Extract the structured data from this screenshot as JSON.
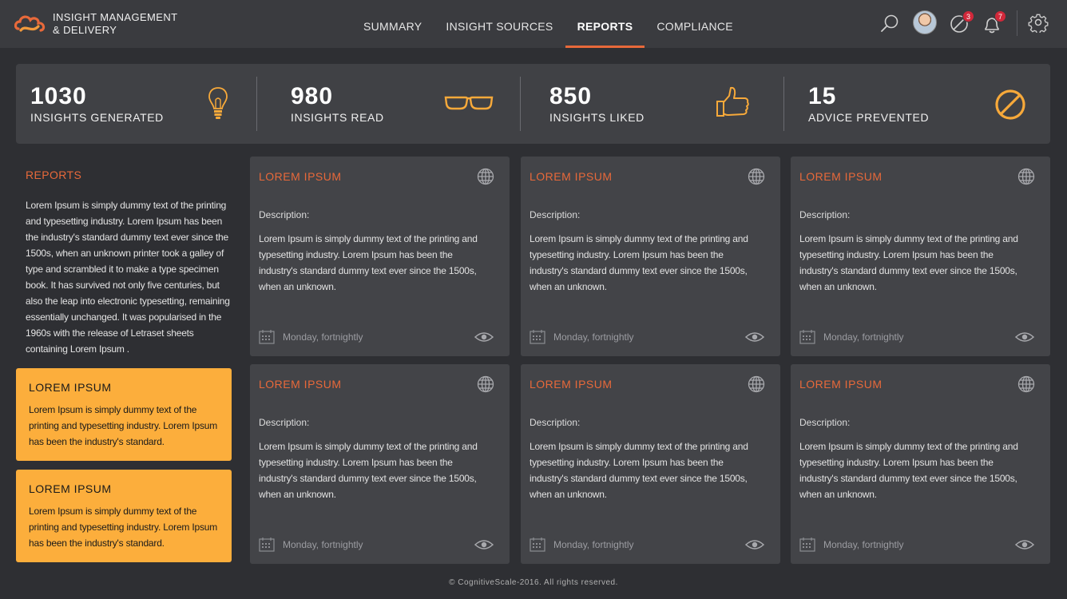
{
  "header": {
    "brand_line1": "INSIGHT MANAGEMENT",
    "brand_line2": "& DELIVERY",
    "nav": [
      {
        "label": "SUMMARY",
        "active": false
      },
      {
        "label": "INSIGHT SOURCES",
        "active": false
      },
      {
        "label": "REPORTS",
        "active": true
      },
      {
        "label": "COMPLIANCE",
        "active": false
      }
    ],
    "blocked_badge": "3",
    "notifications_badge": "7",
    "icons": [
      "search-icon",
      "avatar",
      "blocked-icon",
      "bell-icon",
      "gear-icon"
    ],
    "accent_color": "#e8693a"
  },
  "stats": [
    {
      "value": "1030",
      "label": "INSIGHTS GENERATED",
      "icon": "lightbulb-icon"
    },
    {
      "value": "980",
      "label": "INSIGHTS READ",
      "icon": "glasses-icon"
    },
    {
      "value": "850",
      "label": "INSIGHTS LIKED",
      "icon": "thumbs-up-icon"
    },
    {
      "value": "15",
      "label": "ADVICE PREVENTED",
      "icon": "prohibited-icon"
    }
  ],
  "reports": {
    "title": "REPORTS",
    "description": "Lorem Ipsum is simply dummy text of the printing and typesetting industry. Lorem Ipsum has been the industry's standard dummy text ever since the 1500s, when an unknown printer took a galley of type and scrambled it to make a type specimen book. It has survived not only five centuries, but also the leap into electronic typesetting, remaining essentially unchanged. It was popularised in the 1960s with the release of Letraset sheets containing Lorem Ipsum ."
  },
  "callouts": [
    {
      "title": "LOREM IPSUM",
      "text": "Lorem Ipsum is simply dummy text of the printing and typesetting industry. Lorem Ipsum has been the industry's standard."
    },
    {
      "title": "LOREM IPSUM",
      "text": "Lorem Ipsum is simply dummy text of the printing and typesetting industry. Lorem Ipsum has been the industry's standard."
    }
  ],
  "cards": [
    {
      "title": "LOREM IPSUM",
      "desc_label": "Description:",
      "text": "Lorem Ipsum is simply dummy text of the printing and typesetting industry. Lorem Ipsum has been the industry's standard dummy text ever since the 1500s, when an unknown.",
      "frequency": "Monday, fortnightly"
    },
    {
      "title": "LOREM IPSUM",
      "desc_label": "Description:",
      "text": "Lorem Ipsum is simply dummy text of the printing and typesetting industry. Lorem Ipsum has been the industry's standard dummy text ever since the 1500s, when an unknown.",
      "frequency": "Monday, fortnightly"
    },
    {
      "title": "LOREM IPSUM",
      "desc_label": "Description:",
      "text": "Lorem Ipsum is simply dummy text of the printing and typesetting industry. Lorem Ipsum has been the industry's standard dummy text ever since the 1500s, when an unknown.",
      "frequency": "Monday, fortnightly"
    },
    {
      "title": "LOREM IPSUM",
      "desc_label": "Description:",
      "text": "Lorem Ipsum is simply dummy text of the printing and typesetting industry. Lorem Ipsum has been the industry's standard dummy text ever since the 1500s, when an unknown.",
      "frequency": "Monday, fortnightly"
    },
    {
      "title": "LOREM IPSUM",
      "desc_label": "Description:",
      "text": "Lorem Ipsum is simply dummy text of the printing and typesetting industry. Lorem Ipsum has been the industry's standard dummy text ever since the 1500s, when an unknown.",
      "frequency": "Monday, fortnightly"
    },
    {
      "title": "LOREM IPSUM",
      "desc_label": "Description:",
      "text": "Lorem Ipsum is simply dummy text of the printing and typesetting industry. Lorem Ipsum has been the industry's standard dummy text ever since the 1500s, when an unknown.",
      "frequency": "Monday, fortnightly"
    }
  ],
  "footer": {
    "copyright": "© CognitiveScale-2016. All rights reserved."
  },
  "colors": {
    "accent": "#e8693a",
    "callout": "#fcae3c",
    "stat_icon": "#f7a93a",
    "badge": "#d1283a"
  }
}
